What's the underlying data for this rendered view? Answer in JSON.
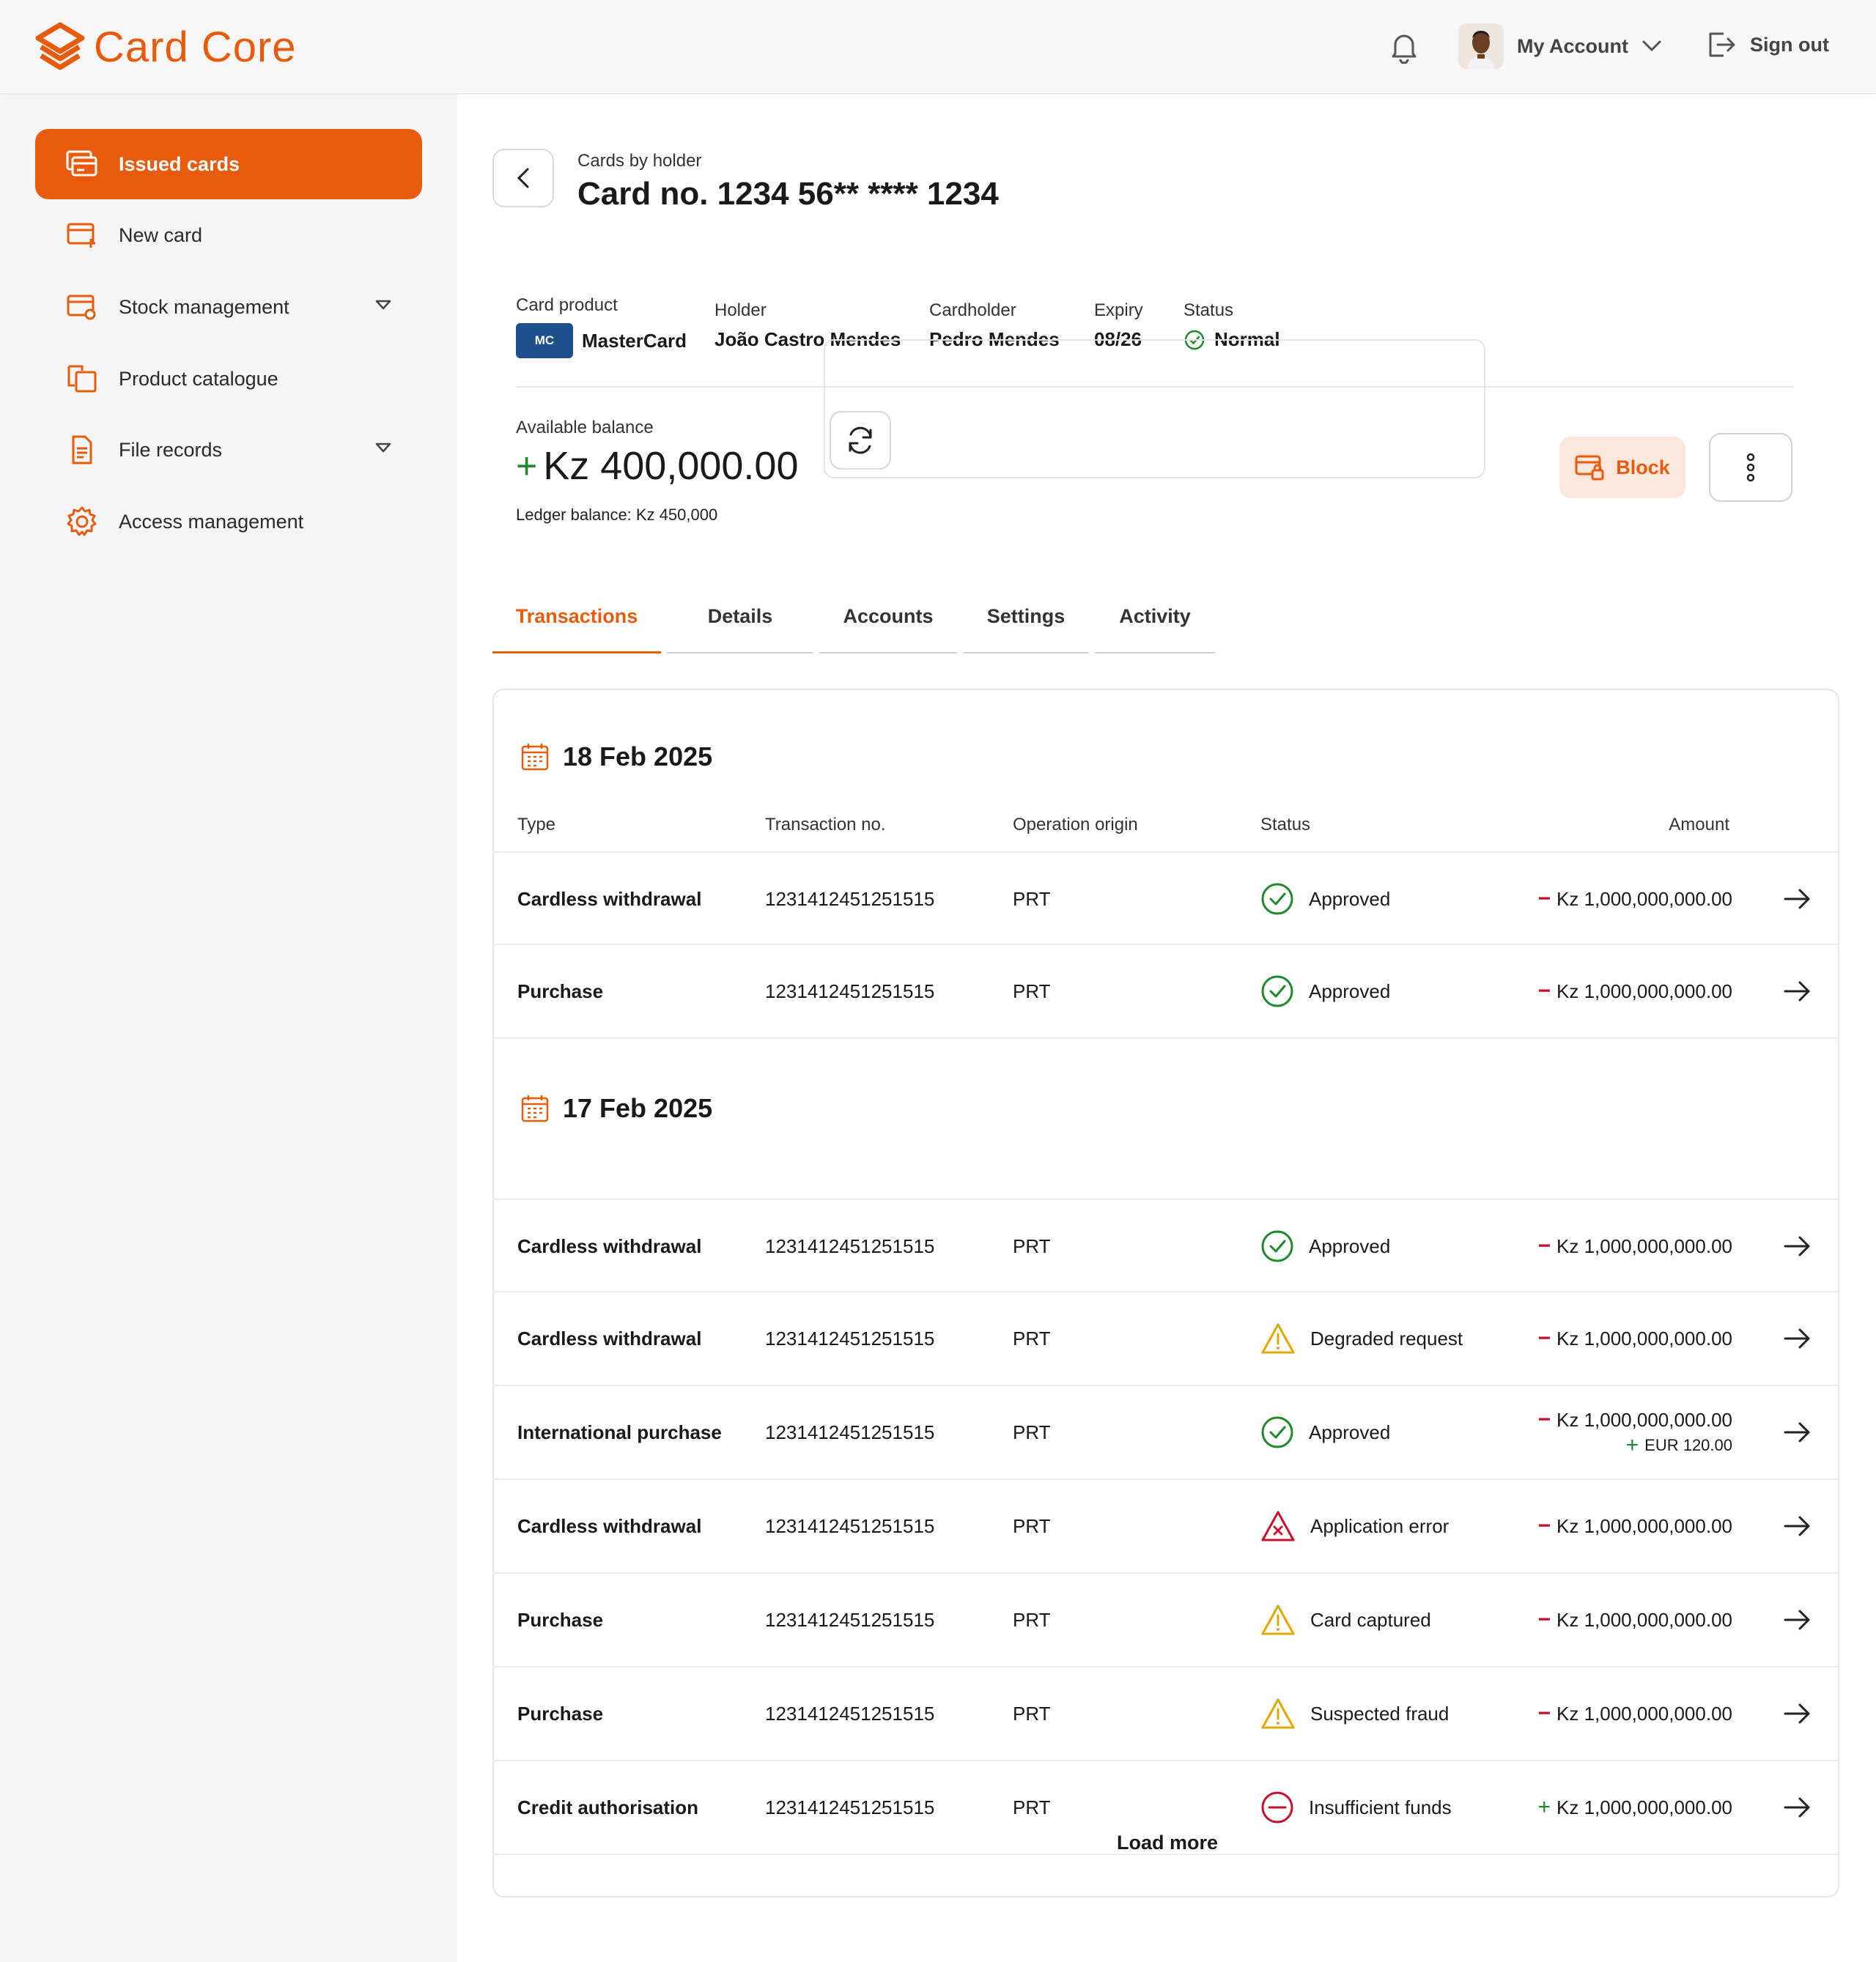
{
  "app": {
    "brand_a": "Card",
    "brand_b": "Core"
  },
  "header": {
    "account_label": "My Account",
    "signout_label": "Sign out"
  },
  "sidebar": {
    "items": [
      {
        "label": "Issued cards"
      },
      {
        "label": "New card"
      },
      {
        "label": "Stock management"
      },
      {
        "label": "Product catalogue"
      },
      {
        "label": "File records"
      },
      {
        "label": "Access management"
      }
    ]
  },
  "page": {
    "breadcrumb": "Cards by holder",
    "title": "Card no. 1234 56** **** 1234"
  },
  "card_info": {
    "product_label": "Card product",
    "product_badge": "MC",
    "product_value": "MasterCard",
    "holder_label": "Holder",
    "holder_value": "João Castro Mendes",
    "cardholder_label": "Cardholder",
    "cardholder_value": "Pedro Mendes",
    "expiry_label": "Expiry",
    "expiry_value": "08/26",
    "status_label": "Status",
    "status_value": "Normal"
  },
  "balance": {
    "available_label": "Available balance",
    "sign": "+",
    "available_value": "Kz 400,000.00",
    "ledger": "Ledger balance: Kz 450,000"
  },
  "actions": {
    "block_label": "Block"
  },
  "tabs": [
    "Transactions",
    "Details",
    "Accounts",
    "Settings",
    "Activity"
  ],
  "table": {
    "headers": {
      "type": "Type",
      "txn": "Transaction no.",
      "origin": "Operation origin",
      "status": "Status",
      "amount": "Amount"
    },
    "load_more": "Load more"
  },
  "groups": [
    {
      "date": "18 Feb 2025",
      "rows": [
        {
          "type": "Cardless withdrawal",
          "txn": "1231412451251515",
          "origin": "PRT",
          "status": "Approved",
          "status_kind": "approved",
          "sign": "−",
          "amount": "Kz 1,000,000,000.00"
        },
        {
          "type": "Purchase",
          "txn": "1231412451251515",
          "origin": "PRT",
          "status": "Approved",
          "status_kind": "approved",
          "sign": "−",
          "amount": "Kz 1,000,000,000.00"
        }
      ]
    },
    {
      "date": "17 Feb 2025",
      "rows": [
        {
          "type": "Cardless withdrawal",
          "txn": "1231412451251515",
          "origin": "PRT",
          "status": "Approved",
          "status_kind": "approved",
          "sign": "−",
          "amount": "Kz 1,000,000,000.00"
        },
        {
          "type": "Cardless withdrawal",
          "txn": "1231412451251515",
          "origin": "PRT",
          "status": "Degraded request",
          "status_kind": "warning",
          "sign": "−",
          "amount": "Kz 1,000,000,000.00"
        },
        {
          "type": "International purchase",
          "txn": "1231412451251515",
          "origin": "PRT",
          "status": "Approved",
          "status_kind": "approved",
          "sign": "−",
          "amount": "Kz 1,000,000,000.00",
          "sub_sign": "+",
          "sub_amount": "EUR 120.00"
        },
        {
          "type": "Cardless withdrawal",
          "txn": "1231412451251515",
          "origin": "PRT",
          "status": "Application error",
          "status_kind": "error",
          "sign": "−",
          "amount": "Kz 1,000,000,000.00"
        },
        {
          "type": "Purchase",
          "txn": "1231412451251515",
          "origin": "PRT",
          "status": "Card captured",
          "status_kind": "warning",
          "sign": "−",
          "amount": "Kz 1,000,000,000.00"
        },
        {
          "type": "Purchase",
          "txn": "1231412451251515",
          "origin": "PRT",
          "status": "Suspected fraud",
          "status_kind": "warning",
          "sign": "−",
          "amount": "Kz 1,000,000,000.00"
        },
        {
          "type": "Credit authorisation",
          "txn": "1231412451251515",
          "origin": "PRT",
          "status": "Insufficient funds",
          "status_kind": "denied",
          "sign": "+",
          "amount": "Kz 1,000,000,000.00"
        }
      ]
    }
  ],
  "colors": {
    "accent": "#e85a0c",
    "approved": "#1f8a2b",
    "warning": "#e0a800",
    "error": "#c8102e"
  }
}
